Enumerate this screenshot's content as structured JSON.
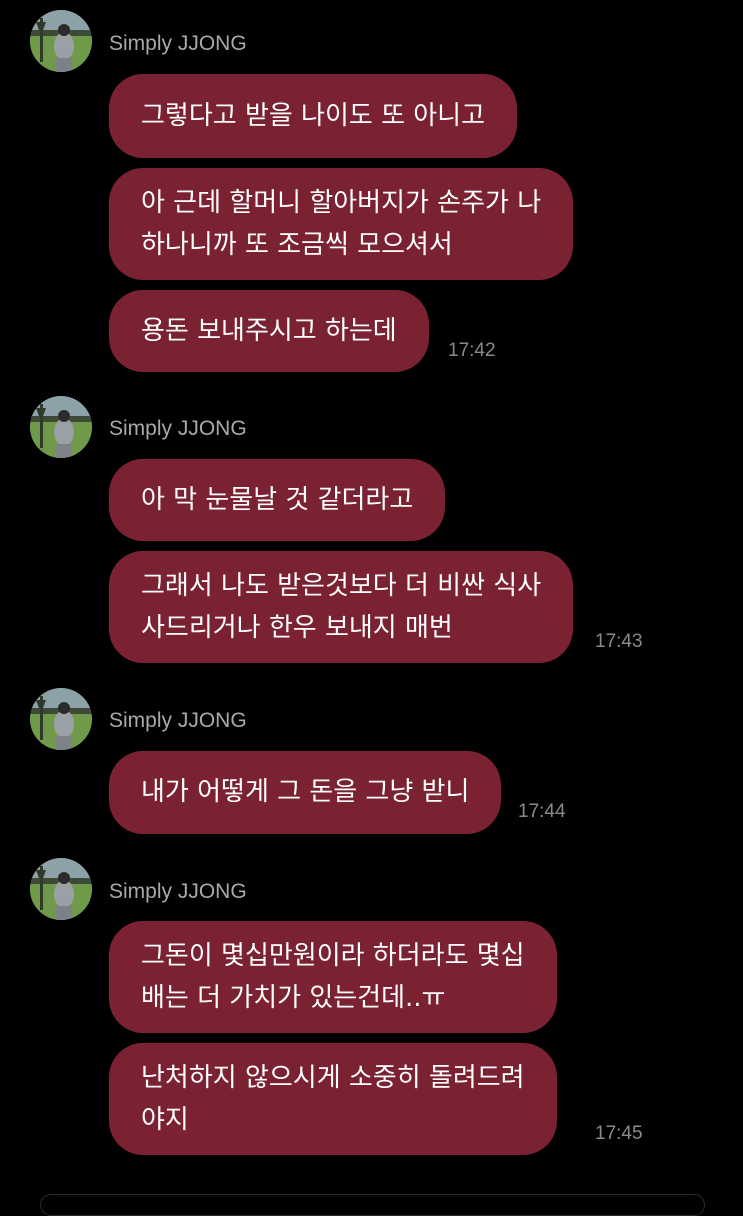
{
  "chat": {
    "groups": [
      {
        "sender": "Simply JJONG",
        "messages": [
          {
            "lines": [
              "그렇다고 받을 나이도 또 아니고"
            ]
          },
          {
            "lines": [
              "아 근데 할머니 할아버지가 손주가 나",
              "하나니까 또 조금씩 모으셔서"
            ]
          },
          {
            "lines": [
              "용돈 보내주시고 하는데"
            ]
          }
        ],
        "time": "17:42"
      },
      {
        "sender": "Simply JJONG",
        "messages": [
          {
            "lines": [
              "아 막 눈물날 것 같더라고"
            ]
          },
          {
            "lines": [
              "그래서 나도 받은것보다 더 비싼 식사",
              "사드리거나 한우 보내지 매번"
            ]
          }
        ],
        "time": "17:43"
      },
      {
        "sender": "Simply JJONG",
        "messages": [
          {
            "lines": [
              "내가 어떻게 그 돈을 그냥 받니"
            ]
          }
        ],
        "time": "17:44"
      },
      {
        "sender": "Simply JJONG",
        "messages": [
          {
            "lines": [
              "그돈이 몇십만원이라 하더라도 몇십",
              "배는 더 가치가 있는건데..ㅠ"
            ]
          },
          {
            "lines": [
              "난처하지 않으시게 소중히 돌려드려",
              "야지"
            ]
          }
        ],
        "time": "17:45"
      }
    ]
  },
  "colors": {
    "background": "#000000",
    "bubble": "#7a2232",
    "sender_text": "#a9a9a9",
    "time_text": "#8a8a8a"
  },
  "icons": {
    "avatar": "profile-photo-baseball-player"
  }
}
